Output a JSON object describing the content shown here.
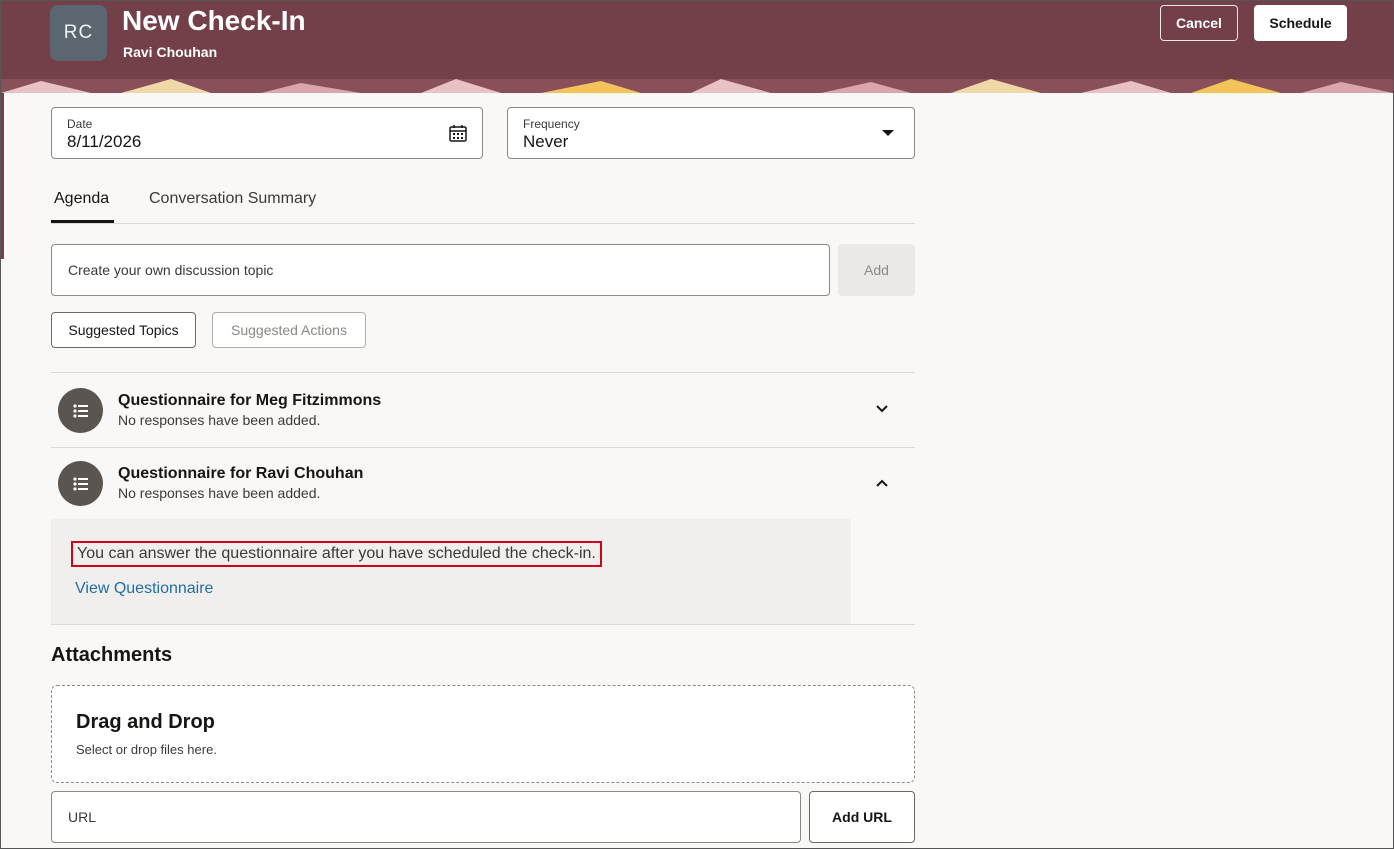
{
  "header": {
    "avatar_initials": "RC",
    "title": "New Check-In",
    "subtitle": "Ravi Chouhan",
    "cancel_label": "Cancel",
    "schedule_label": "Schedule",
    "background_color": "#733f49"
  },
  "form": {
    "date": {
      "label": "Date",
      "value": "8/11/2026",
      "icon": "calendar-icon"
    },
    "frequency": {
      "label": "Frequency",
      "value": "Never",
      "icon": "caret-down-icon"
    }
  },
  "tabs": [
    {
      "label": "Agenda",
      "selected": true
    },
    {
      "label": "Conversation Summary",
      "selected": false
    }
  ],
  "agenda": {
    "topic_placeholder": "Create your own discussion topic",
    "add_label": "Add",
    "suggested_topics_label": "Suggested Topics",
    "suggested_actions_label": "Suggested Actions"
  },
  "questionnaires": [
    {
      "title": "Questionnaire for Meg Fitzimmons",
      "subtitle": "No responses have been added.",
      "expanded": false,
      "icon": "list-icon"
    },
    {
      "title": "Questionnaire for Ravi Chouhan",
      "subtitle": "No responses have been added.",
      "expanded": true,
      "icon": "list-icon",
      "note": "You can answer the questionnaire after you have scheduled the check-in.",
      "link": "View Questionnaire"
    }
  ],
  "attachments": {
    "title": "Attachments",
    "drop_title": "Drag and Drop",
    "drop_subtitle": "Select or drop files here.",
    "url_placeholder": "URL",
    "add_url_label": "Add URL"
  }
}
